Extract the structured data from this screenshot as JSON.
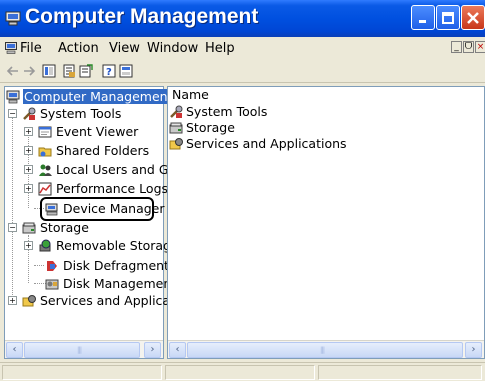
{
  "window": {
    "title": "Computer Management"
  },
  "menu": {
    "items": [
      "File",
      "Action",
      "View",
      "Window",
      "Help"
    ]
  },
  "left_pane": {
    "tree": [
      {
        "label": "Computer Management (",
        "level": 0,
        "selected": true,
        "icon": "computer-management-icon"
      },
      {
        "label": "System Tools",
        "level": 1,
        "expander": "−",
        "icon": "system-tools-icon"
      },
      {
        "label": "Event Viewer",
        "level": 2,
        "expander": "+",
        "icon": "event-viewer-icon"
      },
      {
        "label": "Shared Folders",
        "level": 2,
        "expander": "+",
        "icon": "shared-folders-icon"
      },
      {
        "label": "Local Users and Gr",
        "level": 2,
        "expander": "+",
        "icon": "local-users-icon"
      },
      {
        "label": "Performance Logs",
        "level": 2,
        "expander": "+",
        "icon": "performance-logs-icon"
      },
      {
        "label": "Device Manager",
        "level": 2,
        "icon": "device-manager-icon"
      },
      {
        "label": "Storage",
        "level": 1,
        "expander": "−",
        "icon": "storage-icon"
      },
      {
        "label": "Removable Storag",
        "level": 2,
        "expander": "+",
        "icon": "removable-storage-icon"
      },
      {
        "label": "Disk Defragmenter",
        "level": 2,
        "icon": "disk-defragmenter-icon"
      },
      {
        "label": "Disk Management",
        "level": 2,
        "icon": "disk-management-icon"
      },
      {
        "label": "Services and Applicat",
        "level": 1,
        "expander": "+",
        "icon": "services-applications-icon"
      }
    ]
  },
  "right_pane": {
    "column_header": "Name",
    "items": [
      {
        "label": "System Tools",
        "icon": "system-tools-icon"
      },
      {
        "label": "Storage",
        "icon": "storage-icon"
      },
      {
        "label": "Services and Applications",
        "icon": "services-applications-icon"
      }
    ]
  },
  "scroll": {
    "left_arrow": "‹",
    "right_arrow": "›",
    "grip": "|||"
  },
  "mdi_controls": {
    "minimize": "_",
    "restore": "ᗜ",
    "close": "×"
  },
  "colors": {
    "titlebar": "#0050e0",
    "selection": "#316ac5",
    "close_button": "#d2462a"
  }
}
